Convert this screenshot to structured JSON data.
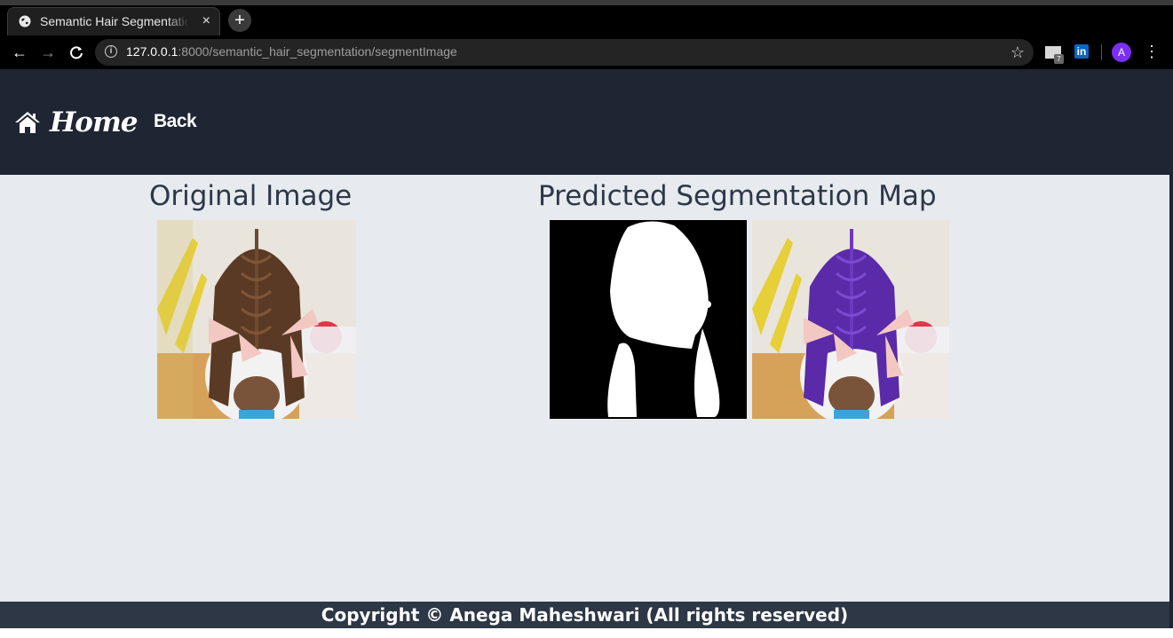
{
  "browser": {
    "tab_title": "Semantic Hair Segmentation",
    "tab_close": "×",
    "new_tab": "+",
    "url_host": "127.0.0.1",
    "url_path": ":8000/semantic_hair_segmentation/segmentImage",
    "avatar_initial": "A",
    "mail_badge": "7",
    "linkedin_label": "in"
  },
  "nav": {
    "home_label": "Home",
    "back_label": "Back"
  },
  "main": {
    "original_title": "Original Image",
    "predicted_title": "Predicted Segmentation Map"
  },
  "footer": {
    "copyright": "Copyright © Anega Maheshwari (All rights reserved)"
  },
  "colors": {
    "header_bg": "#1f2533",
    "page_bg": "#e7eaee",
    "footer_bg": "#2d3745",
    "title_text": "#2d3748",
    "hair_overlay": "#5a2aa8"
  }
}
